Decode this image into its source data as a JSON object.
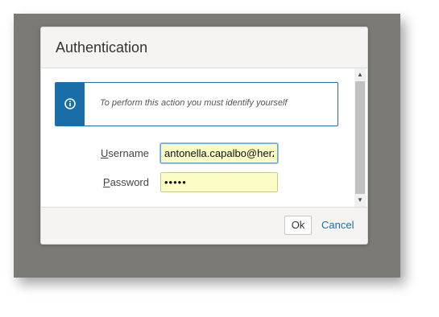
{
  "dialog": {
    "title": "Authentication",
    "info_message": "To perform this action you must identify yourself",
    "info_icon": "info-circle-icon"
  },
  "form": {
    "username_label_accesskey": "U",
    "username_label_rest": "sername",
    "username_value": "antonella.capalbo@herzum",
    "password_label_accesskey": "P",
    "password_label_rest": "assword",
    "password_value": "•••••"
  },
  "footer": {
    "ok_label": "Ok",
    "cancel_label": "Cancel"
  },
  "colors": {
    "backdrop": "#7b7a75",
    "accent": "#1a6ea8",
    "input_background": "#fbfbc5"
  }
}
